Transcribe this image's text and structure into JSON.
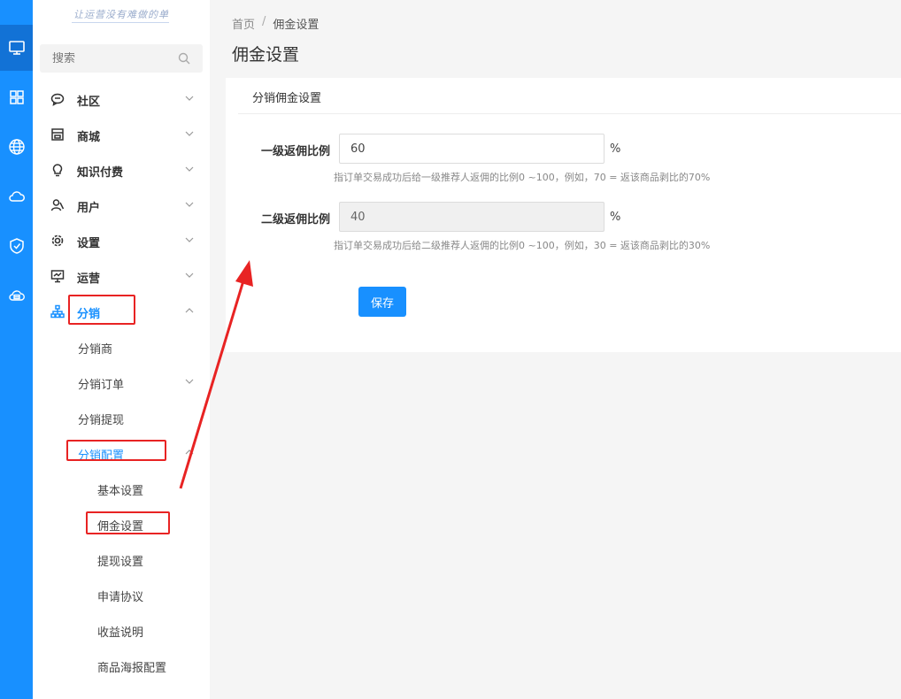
{
  "brand": {
    "text": "让运营没有难做的单"
  },
  "search": {
    "placeholder": "搜索"
  },
  "menu": {
    "community": "社区",
    "mall": "商城",
    "knowledge": "知识付费",
    "user": "用户",
    "settings": "设置",
    "operation": "运营",
    "distribution": "分销"
  },
  "distribution_sub": {
    "distributor": "分销商",
    "orders": "分销订单",
    "withdraw": "分销提现",
    "config": "分销配置"
  },
  "config_sub": {
    "basic": "基本设置",
    "commission": "佣金设置",
    "withdraw": "提现设置",
    "agreement": "申请协议",
    "earnings": "收益说明",
    "poster": "商品海报配置"
  },
  "breadcrumb": {
    "home": "首页",
    "separator": "/",
    "current": "佣金设置"
  },
  "page_title": "佣金设置",
  "panel": {
    "title": "分销佣金设置",
    "level1": {
      "label": "一级返佣比例",
      "value": "60",
      "unit": "%",
      "hint": "指订单交易成功后给一级推荐人返佣的比例0 ~100，例如，70 = 返该商品剥比的70%"
    },
    "level2": {
      "label": "二级返佣比例",
      "value": "40",
      "unit": "%",
      "hint": "指订单交易成功后给二级推荐人返佣的比例0 ~100，例如，30 = 返该商品剥比的30%"
    },
    "save_label": "保存"
  },
  "colors": {
    "primary": "#1890ff",
    "highlight": "#e82323",
    "rail": "#1890ff"
  }
}
